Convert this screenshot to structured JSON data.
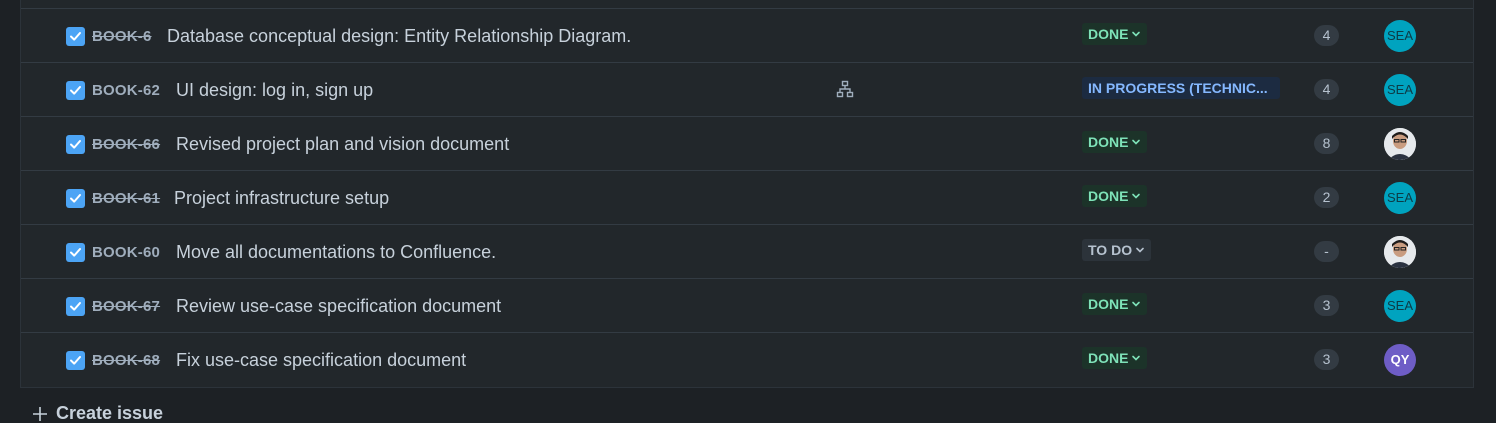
{
  "issues": [
    {
      "key": "BOOK-6",
      "summary": "Database conceptual design: Entity Relationship Diagram.",
      "status": "DONE",
      "points": "4",
      "assignee": "SEA",
      "key_done": true,
      "has_children": false
    },
    {
      "key": "BOOK-62",
      "summary": "UI design: log in, sign up",
      "status": "IN PROGRESS (TECHNIC...",
      "points": "4",
      "assignee": "SEA",
      "key_done": false,
      "has_children": true
    },
    {
      "key": "BOOK-66",
      "summary": "Revised project plan and vision document",
      "status": "DONE",
      "points": "8",
      "assignee": "photo",
      "key_done": true,
      "has_children": false
    },
    {
      "key": "BOOK-61",
      "summary": "Project infrastructure setup",
      "status": "DONE",
      "points": "2",
      "assignee": "SEA",
      "key_done": true,
      "has_children": false
    },
    {
      "key": "BOOK-60",
      "summary": "Move all documentations to Confluence.",
      "status": "TO DO",
      "points": "-",
      "assignee": "photo",
      "key_done": false,
      "has_children": false
    },
    {
      "key": "BOOK-67",
      "summary": "Review use-case specification document",
      "status": "DONE",
      "points": "3",
      "assignee": "SEA",
      "key_done": true,
      "has_children": false
    },
    {
      "key": "BOOK-68",
      "summary": "Fix use-case specification document",
      "status": "DONE",
      "points": "3",
      "assignee": "QY",
      "key_done": true,
      "has_children": false
    }
  ],
  "footer": {
    "create_label": "Create issue"
  },
  "colors": {
    "background": "#1d2125",
    "row_bg": "#22272b",
    "checkbox": "#4ca4f5",
    "done_badge_bg": "#1c3329",
    "done_badge_text": "#7ee2b8",
    "progress_badge_bg": "#1c2b41",
    "progress_badge_text": "#85b8ff",
    "todo_badge_bg": "#2c333a",
    "avatar_sea": "#00a3bf",
    "avatar_qy": "#6e5dc6"
  },
  "icons": {
    "checkbox": "checkbox-checked-icon",
    "child_issues": "child-issues-icon",
    "status_dropdown": "chevron-down-icon",
    "create": "plus-icon"
  }
}
